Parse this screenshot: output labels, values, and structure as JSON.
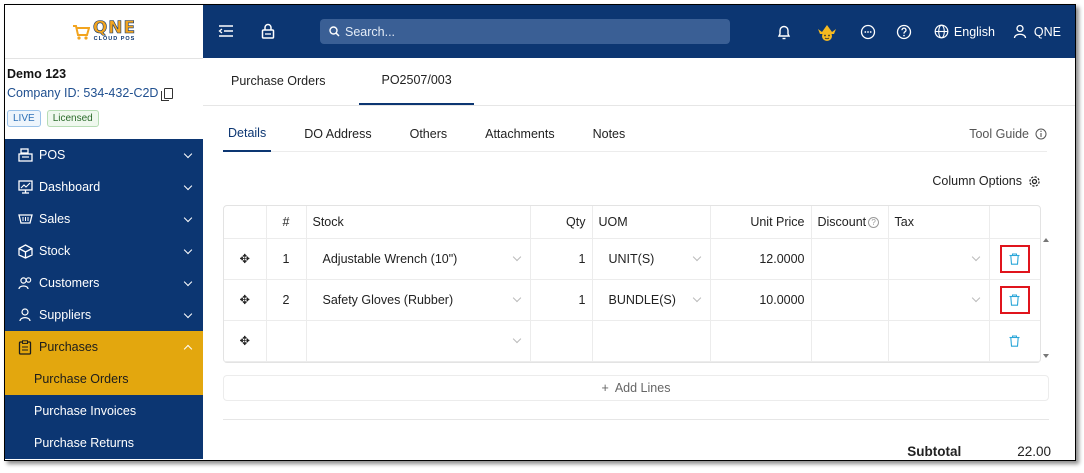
{
  "logo": {
    "main": "QNE",
    "sub": "CLOUD POS"
  },
  "company": {
    "name": "Demo 123",
    "id": "Company ID: 534-432-C2D",
    "badge_live": "LIVE",
    "badge_licensed": "Licensed"
  },
  "nav": {
    "pos": "POS",
    "dashboard": "Dashboard",
    "sales": "Sales",
    "stock": "Stock",
    "customers": "Customers",
    "suppliers": "Suppliers",
    "purchases": "Purchases",
    "purchase_orders": "Purchase Orders",
    "purchase_invoices": "Purchase Invoices",
    "purchase_returns": "Purchase Returns"
  },
  "topbar": {
    "search_placeholder": "Search...",
    "language": "English",
    "user": "QNE"
  },
  "tabs_top": [
    "Purchase Orders",
    "PO2507/003"
  ],
  "tabs_sub": [
    "Details",
    "DO Address",
    "Others",
    "Attachments",
    "Notes"
  ],
  "tool_guide": "Tool Guide",
  "column_options": "Column Options",
  "table": {
    "headers": {
      "index": "#",
      "stock": "Stock",
      "qty": "Qty",
      "uom": "UOM",
      "unit_price": "Unit Price",
      "discount": "Discount",
      "tax": "Tax"
    },
    "rows": [
      {
        "index": "1",
        "stock": "Adjustable Wrench (10\")",
        "qty": "1",
        "uom": "UNIT(S)",
        "unit_price": "12.0000",
        "discount": "",
        "tax": ""
      },
      {
        "index": "2",
        "stock": "Safety Gloves (Rubber)",
        "qty": "1",
        "uom": "BUNDLE(S)",
        "unit_price": "10.0000",
        "discount": "",
        "tax": ""
      }
    ]
  },
  "add_lines": "Add Lines",
  "subtotal": {
    "label": "Subtotal",
    "value": "22.00"
  },
  "colors": {
    "navy": "#0c3672",
    "accent": "#e3a70e",
    "trash": "#2aa6d8",
    "highlight": "#e0141c"
  }
}
